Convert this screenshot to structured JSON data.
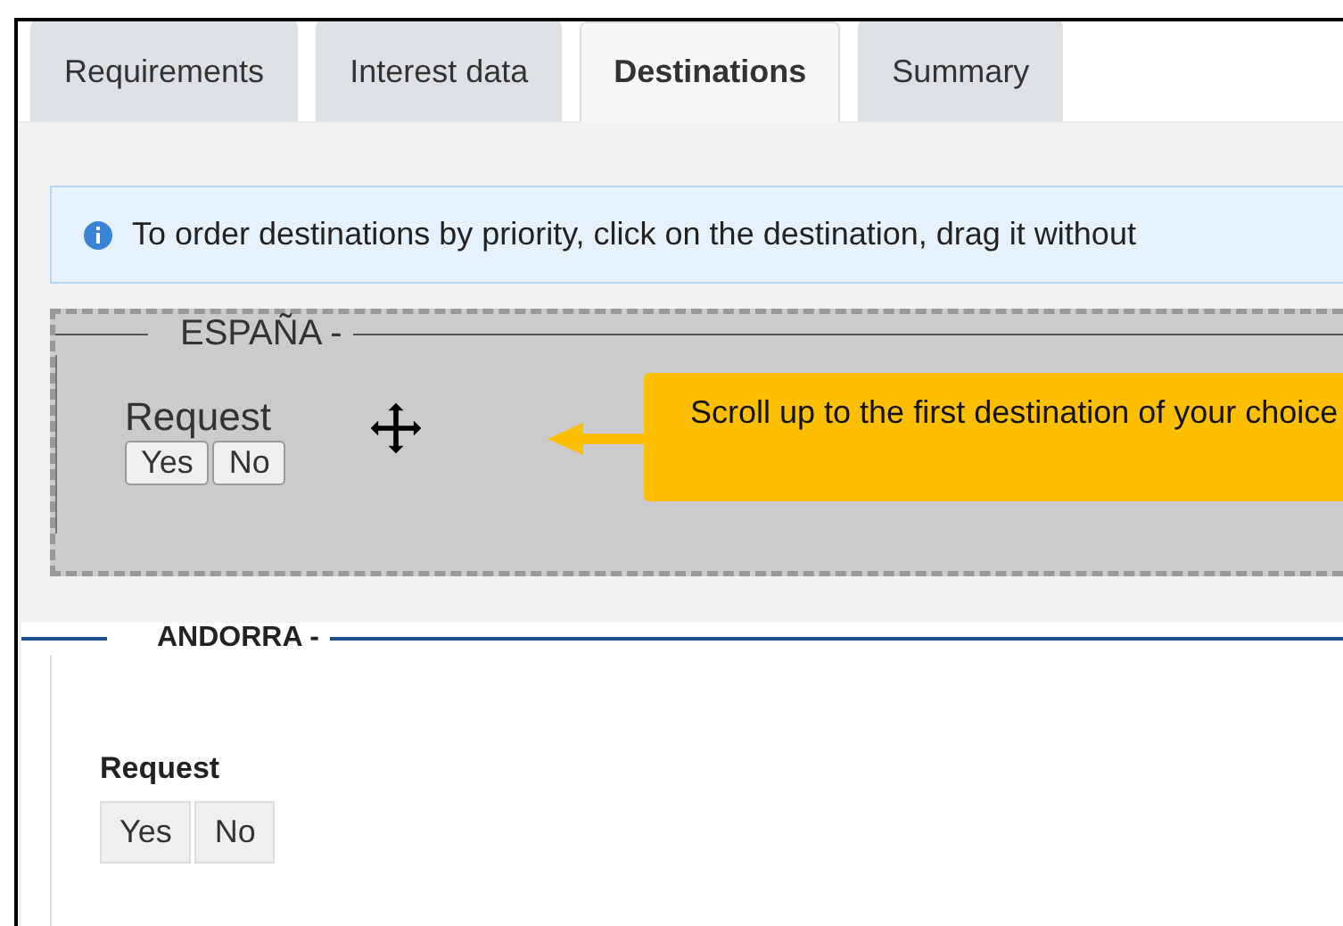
{
  "tabs": [
    {
      "label": "Requirements",
      "selected": false
    },
    {
      "label": "Interest data",
      "selected": false
    },
    {
      "label": "Destinations",
      "selected": true
    },
    {
      "label": "Summary",
      "selected": false
    }
  ],
  "info": {
    "text": "To order destinations by priority, click on the destination, drag it without"
  },
  "destinations": [
    {
      "name": "ESPAÑA -",
      "kind": "dragging",
      "question": "Request",
      "options": [
        "Yes",
        "No"
      ]
    },
    {
      "name": "ANDORRA -",
      "kind": "normal",
      "question": "Request",
      "options": [
        "Yes",
        "No"
      ]
    }
  ],
  "callout": {
    "text": "Scroll up to the first destination of your choice"
  }
}
